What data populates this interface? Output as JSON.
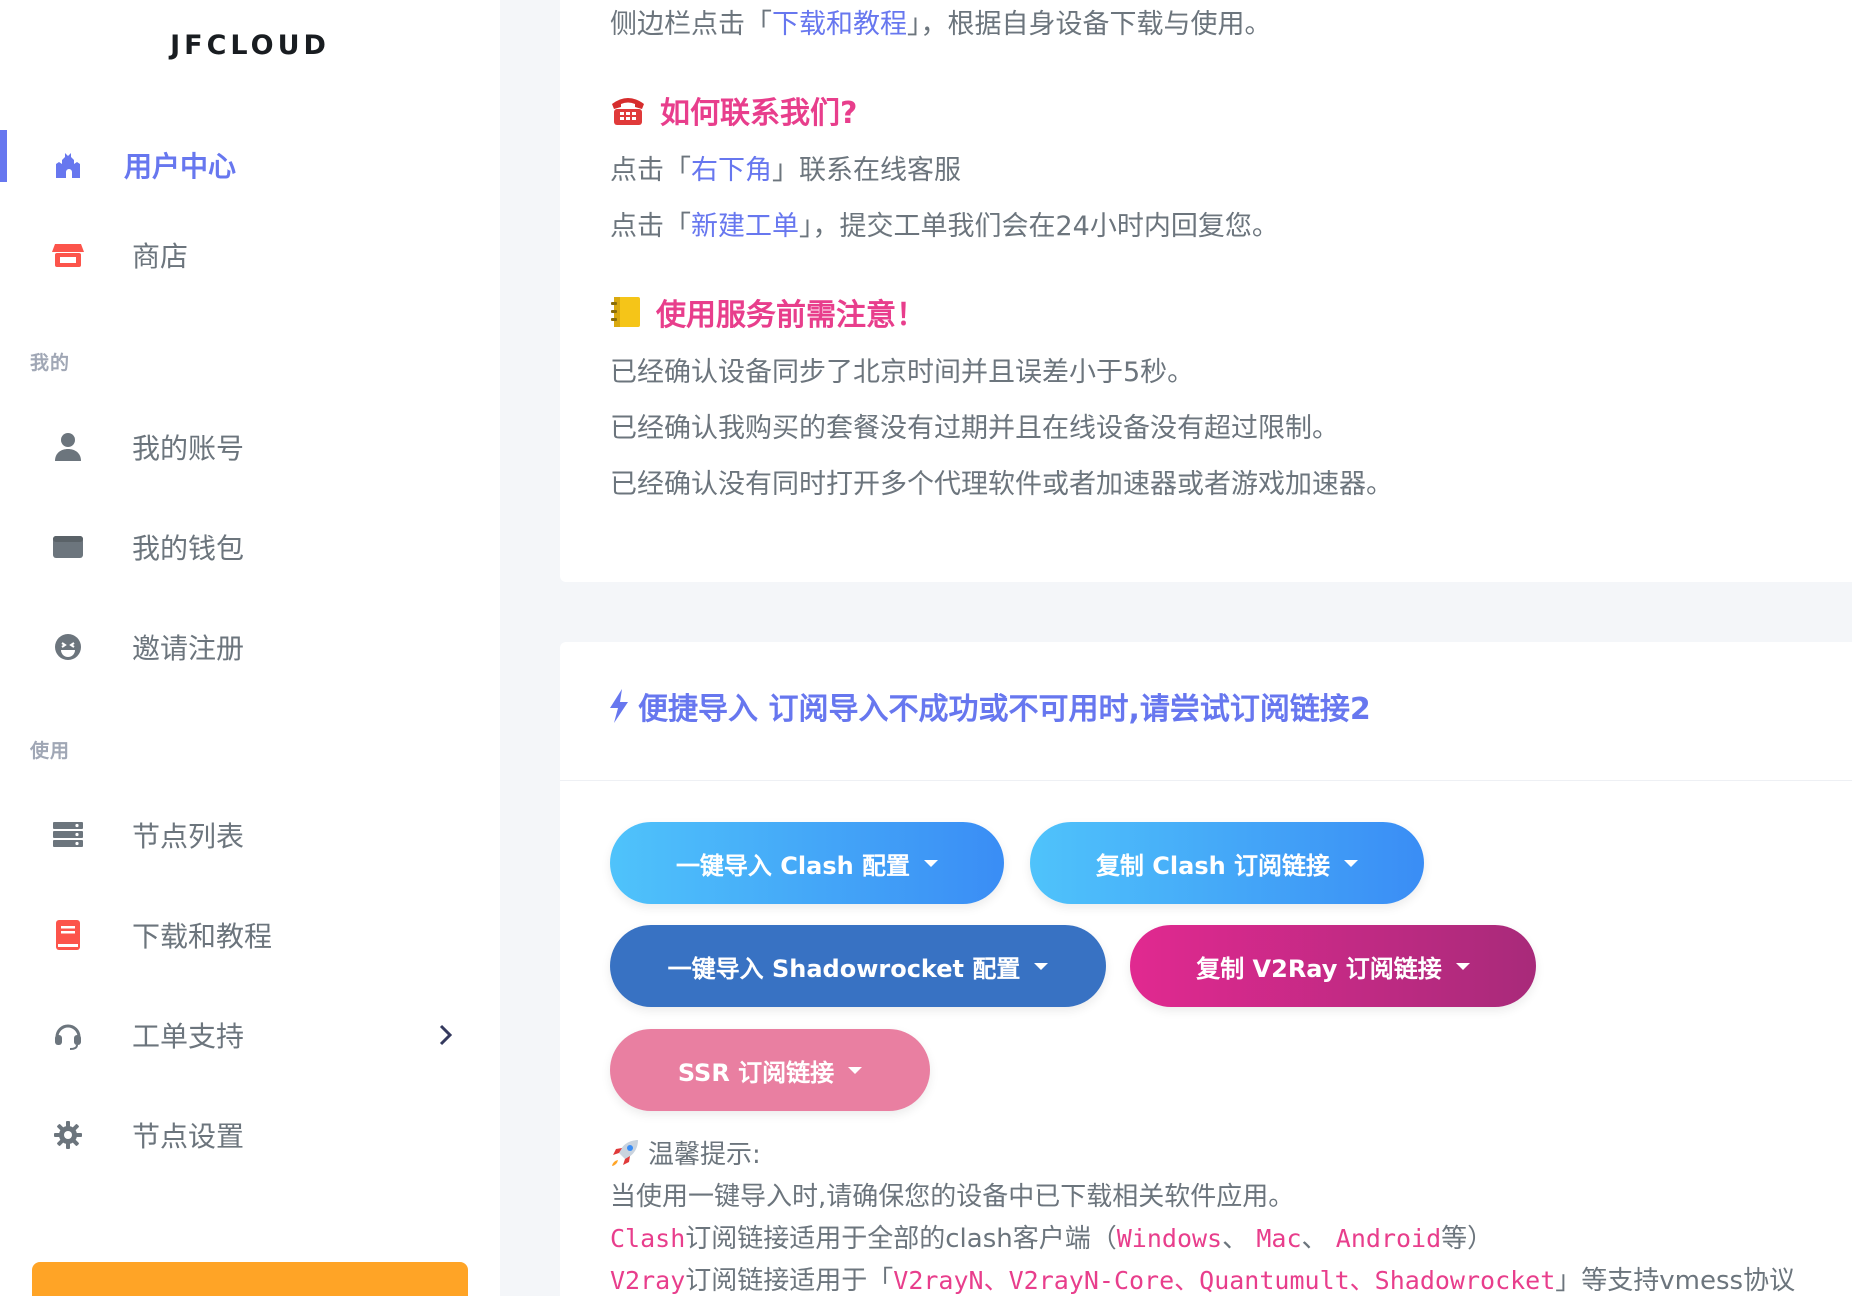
{
  "sidebar": {
    "brand": "JFCLOUD",
    "items": [
      {
        "label": "用户中心",
        "icon": "castle-icon",
        "active": true
      },
      {
        "label": "商店",
        "icon": "store-icon"
      },
      {
        "label": "我的账号",
        "icon": "user-icon"
      },
      {
        "label": "我的钱包",
        "icon": "wallet-icon"
      },
      {
        "label": "邀请注册",
        "icon": "laugh-face-icon"
      },
      {
        "label": "节点列表",
        "icon": "server-icon"
      },
      {
        "label": "下载和教程",
        "icon": "book-icon"
      },
      {
        "label": "工单支持",
        "icon": "headset-icon"
      },
      {
        "label": "节点设置",
        "icon": "gear-icon"
      }
    ],
    "headers": {
      "mine": "我的",
      "use": "使用"
    }
  },
  "card1": {
    "line_top": {
      "pre": "侧边栏点击「",
      "link": "下载和教程",
      "post": "」，根据自身设备下载与使用。"
    },
    "contact_heading": "如何联系我们?",
    "contact_line1": {
      "pre": "点击「",
      "link": "右下角",
      "post": "」联系在线客服"
    },
    "contact_line2": {
      "pre": "点击「",
      "link": "新建工单",
      "post": "」，提交工单我们会在24小时内回复您。"
    },
    "notice_heading": "使用服务前需注意！",
    "notice_lines": [
      "已经确认设备同步了北京时间并且误差小于5秒。",
      "已经确认我购买的套餐没有过期并且在线设备没有超过限制。",
      "已经确认没有同时打开多个代理软件或者加速器或者游戏加速器。"
    ]
  },
  "card2": {
    "title": "便捷导入 订阅导入不成功或不可用时,请尝试订阅链接2",
    "buttons": [
      "一键导入 Clash 配置",
      "复制 Clash 订阅链接",
      "一键导入 Shadowrocket 配置",
      "复制 V2Ray 订阅链接",
      "SSR 订阅链接"
    ],
    "tip_title": "温馨提示:",
    "tip_line1": "当使用一键导入时,请确保您的设备中已下载相关软件应用。",
    "tip_line2": {
      "code1": "Clash",
      "text1": "订阅链接适用于全部的clash客户端（",
      "code2": "Windows",
      "sep1": "、 ",
      "code3": "Mac",
      "sep2": "、 ",
      "code4": "Android",
      "text2": "等）"
    },
    "tip_line3": {
      "code1": "V2ray",
      "text1": "订阅链接适用于「",
      "code2": "V2rayN、V2rayN-Core、Quantumult、Shadowrocket",
      "text2": "」等支持vmess协议"
    }
  },
  "colors": {
    "primary": "#6777ef",
    "accent_pink": "#e83e8c",
    "text": "#6c757d",
    "warning": "#ffa426"
  }
}
